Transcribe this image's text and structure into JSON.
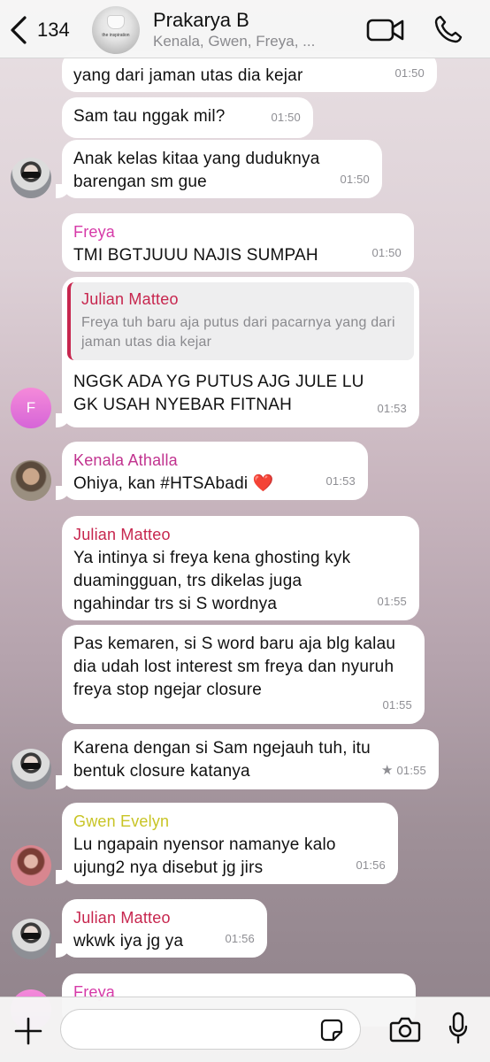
{
  "header": {
    "back_count": "134",
    "group_name": "Prakarya B",
    "members": "Kenala, Gwen, Freya, ...",
    "avatar_text": "the inspiration"
  },
  "messages": [
    {
      "text": "yang dari jaman utas dia kejar",
      "time": "01:50"
    },
    {
      "text": "Sam tau nggak mil?",
      "time": "01:50"
    },
    {
      "text": "Anak kelas kitaa yang duduknya barengan sm gue",
      "time": "01:50"
    },
    {
      "sender": "Freya",
      "text": "TMI BGTJUUU NAJIS SUMPAH",
      "time": "01:50",
      "sender_color": "#d63aa8"
    },
    {
      "reply_name": "Julian Matteo",
      "reply_text": "Freya tuh baru aja putus dari pacarnya yang dari jaman utas dia kejar",
      "text": "NGGK ADA YG PUTUS AJG JULE LU GK USAH NYEBAR FITNAH",
      "time": "01:53",
      "avatar_initial": "F"
    },
    {
      "sender": "Kenala Athalla",
      "text": "Ohiya, kan #HTSAbadi ❤️",
      "time": "01:53",
      "sender_color": "#c1338f"
    },
    {
      "sender": "Julian Matteo",
      "text": "Ya intinya si freya kena ghosting kyk duamingguan, trs dikelas juga ngahindar trs si S wordnya",
      "time": "01:55",
      "sender_color": "#c7264e"
    },
    {
      "text": "Pas kemaren, si S word baru aja blg kalau dia udah lost interest sm freya dan nyuruh freya stop ngejar closure",
      "time": "01:55"
    },
    {
      "text": "Karena dengan si Sam ngejauh tuh, itu bentuk closure katanya",
      "time": "01:55",
      "starred": "★"
    },
    {
      "sender": "Gwen Evelyn",
      "text": "Lu ngapain nyensor namanye kalo ujung2 nya disebut jg jirs",
      "time": "01:56",
      "sender_color": "#c8c425"
    },
    {
      "sender": "Julian Matteo",
      "text": "wkwk iya jg ya",
      "time": "01:56",
      "sender_color": "#c7264e"
    },
    {
      "sender": "Freya",
      "sender_color": "#d63aa8"
    }
  ],
  "input": {
    "placeholder": "",
    "value": ""
  },
  "icons": {
    "back": "chevron-left-icon",
    "video": "video-camera-icon",
    "call": "phone-icon",
    "plus": "plus-icon",
    "sticker": "sticker-icon",
    "camera": "camera-icon",
    "mic": "microphone-icon"
  }
}
